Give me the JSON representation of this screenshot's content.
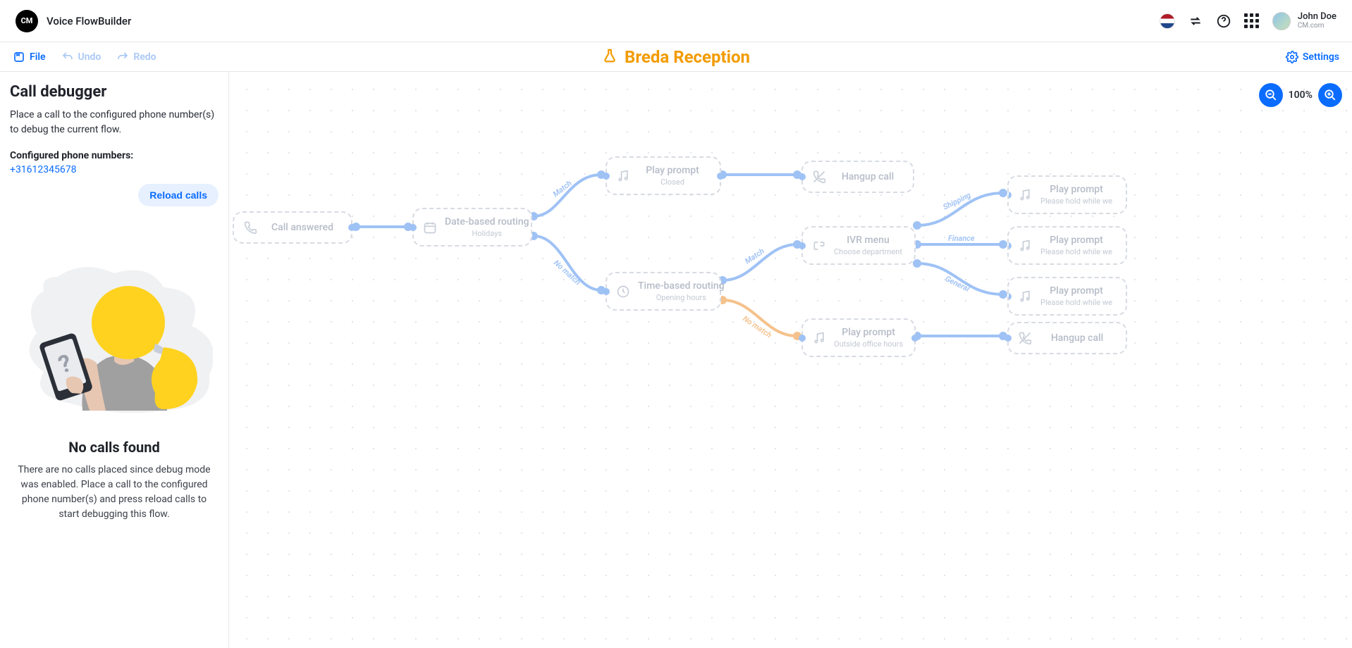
{
  "app": {
    "logo_text": "CM",
    "title": "Voice FlowBuilder"
  },
  "user": {
    "name": "John Doe",
    "org": "CM.com"
  },
  "toolbar": {
    "file": "File",
    "undo": "Undo",
    "redo": "Redo",
    "flow_title": "Breda Reception",
    "settings": "Settings"
  },
  "zoom": {
    "level": "100%"
  },
  "sidebar": {
    "title": "Call debugger",
    "desc": "Place a call to the configured phone number(s) to debug the current flow.",
    "phones_label": "Configured phone numbers:",
    "phones": [
      "+31612345678"
    ],
    "reload": "Reload calls",
    "empty_title": "No calls found",
    "empty_desc": "There are no calls placed since debug mode was enabled. Place a call to the configured phone number(s) and press reload calls to start debugging this flow."
  },
  "nodes": {
    "call_answered": {
      "title": "Call answered"
    },
    "date_routing": {
      "title": "Date-based routing",
      "sub": "Holidays"
    },
    "play_closed": {
      "title": "Play prompt",
      "sub": "Closed"
    },
    "hangup1": {
      "title": "Hangup call"
    },
    "time_routing": {
      "title": "Time-based routing",
      "sub": "Opening hours"
    },
    "ivr": {
      "title": "IVR menu",
      "sub": "Choose department"
    },
    "play_outside": {
      "title": "Play prompt",
      "sub": "Outside office hours"
    },
    "play_shipping": {
      "title": "Play prompt",
      "sub": "Please hold while we"
    },
    "play_finance": {
      "title": "Play prompt",
      "sub": "Please hold while we"
    },
    "play_general": {
      "title": "Play prompt",
      "sub": "Please hold while we"
    },
    "hangup2": {
      "title": "Hangup call"
    }
  },
  "edges": {
    "match": "Match",
    "no_match": "No match",
    "shipping": "Shipping",
    "finance": "Finance",
    "general": "General"
  }
}
